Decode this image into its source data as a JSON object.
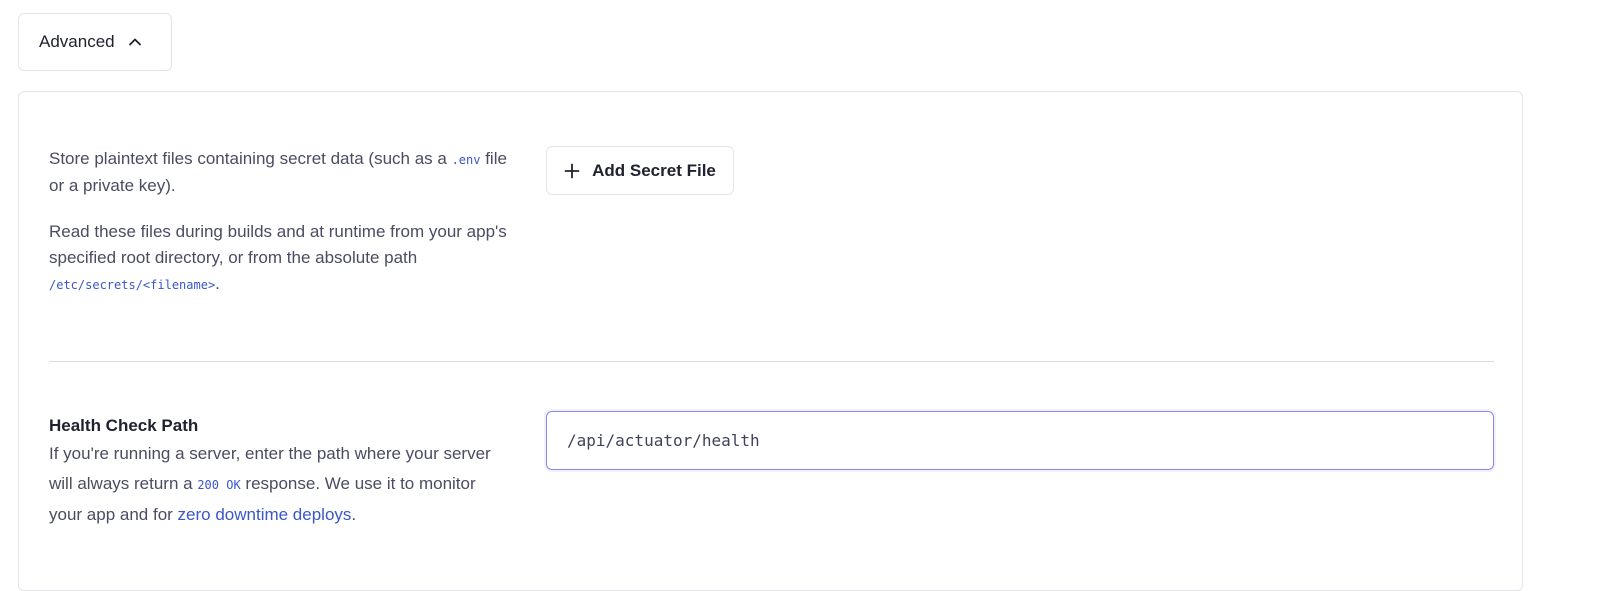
{
  "advanced": {
    "label": "Advanced",
    "chevron_icon": "chevron-up-icon"
  },
  "secret_files": {
    "desc_p1_before": "Store plaintext files containing secret data (such as a ",
    "desc_p1_code": ".env",
    "desc_p1_after": " file or a private key).",
    "desc_p2_before": "Read these files during builds and at runtime from your app's specified root directory, or from the absolute path ",
    "desc_p2_code": "/etc/secrets/<filename>",
    "desc_p2_after": ".",
    "add_button_label": "Add Secret File",
    "add_button_icon": "plus-icon"
  },
  "health_check": {
    "title": "Health Check Path",
    "desc_before": "If you're running a server, enter the path where your server will always return a ",
    "desc_code": "200 OK",
    "desc_middle": " response. We use it to monitor your app and for ",
    "desc_link": "zero downtime deploys",
    "desc_after": ".",
    "input_value": "/api/actuator/health"
  },
  "colors": {
    "link": "#3a56c8",
    "input_focus_border": "#8b86f0",
    "border": "#e3e4ea"
  }
}
